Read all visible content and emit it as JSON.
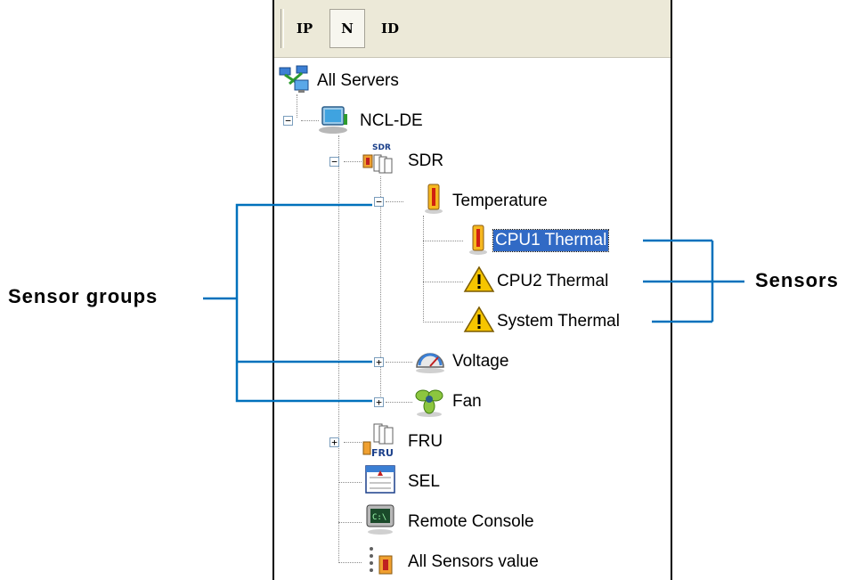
{
  "toolbar": {
    "buttons": [
      "IP",
      "N",
      "ID"
    ],
    "pressed_index": 1
  },
  "tree": {
    "root": "All Servers",
    "server": "NCL-DE",
    "sdr": "SDR",
    "sdr_badge": "SDR",
    "temperature": "Temperature",
    "cpu1": "CPU1 Thermal",
    "cpu2": "CPU2 Thermal",
    "system": "System Thermal",
    "voltage": "Voltage",
    "fan": "Fan",
    "fru": "FRU",
    "fru_badge": "FRU",
    "sel": "SEL",
    "console": "Remote Console",
    "console_badge": "C:\\",
    "all_sensors": "All Sensors value"
  },
  "callouts": {
    "left": "Sensor groups",
    "right": "Sensors"
  },
  "colors": {
    "callout_line": "#0071bc",
    "selection": "#316ac5",
    "warning": "#f6c500"
  }
}
